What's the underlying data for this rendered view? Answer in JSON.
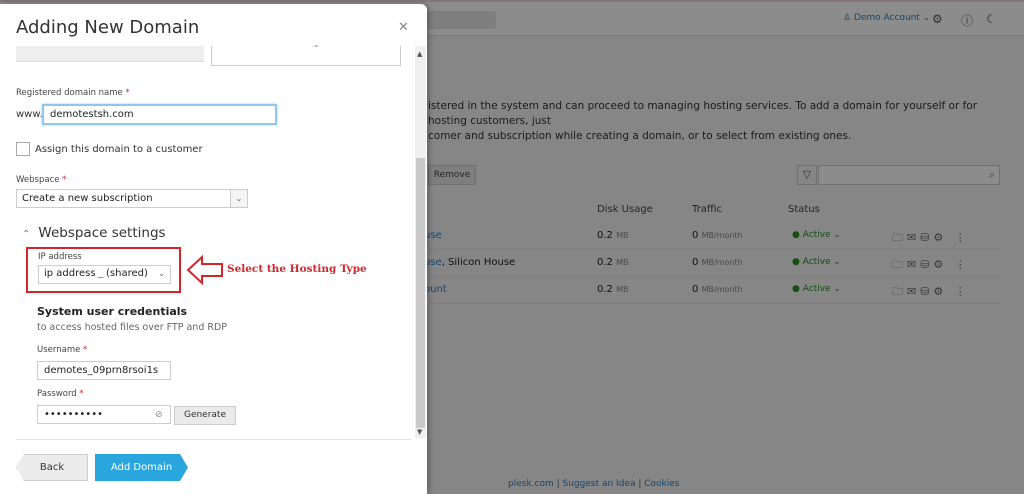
{
  "background": {
    "account": "Demo Account",
    "description_line1": "istered in the system and can proceed to managing hosting services. To add a domain for yourself or for hosting customers, just",
    "description_line2": "comer and subscription while creating a domain, or to select from existing ones.",
    "remove_label": "Remove",
    "columns": [
      "Disk Usage",
      "Traffic",
      "Status"
    ],
    "rows": [
      {
        "name": "use",
        "suffix": "",
        "disk": "0.2",
        "disk_unit": "MB",
        "traffic": "0",
        "traffic_unit": "MB/month",
        "status": "Active"
      },
      {
        "name": "use",
        "suffix": ", Silicon House",
        "disk": "0.2",
        "disk_unit": "MB",
        "traffic": "0",
        "traffic_unit": "MB/month",
        "status": "Active"
      },
      {
        "name": "ount",
        "suffix": "",
        "disk": "0.2",
        "disk_unit": "MB",
        "traffic": "0",
        "traffic_unit": "MB/month",
        "status": "Active"
      }
    ],
    "footer": [
      "plesk.com",
      "Suggest an Idea",
      "Cookies"
    ]
  },
  "modal": {
    "title": "Adding New Domain",
    "registered_label": "Registered domain name",
    "www_prefix": "www.",
    "domain_value": "demotestsh.com",
    "assign_label": "Assign this domain to a customer",
    "webspace_label": "Webspace",
    "webspace_value": "Create a new subscription",
    "settings_title": "Webspace settings",
    "ip_label": "IP address",
    "ip_value": "ip address",
    "ip_type": "(shared)",
    "annotation": "Select the Hosting Type",
    "cred_title": "System user credentials",
    "cred_sub": "to access hosted files over FTP and RDP",
    "username_label": "Username",
    "username_value": "demotes_09prn8rsoi1s",
    "password_label": "Password",
    "password_value": "••••••••••",
    "generate_label": "Generate",
    "back_label": "Back",
    "add_label": "Add Domain"
  },
  "colors": {
    "accent": "#2aa6de",
    "annotation": "#d3252c",
    "active": "#2b8a2b",
    "link": "#2a7fc9"
  }
}
